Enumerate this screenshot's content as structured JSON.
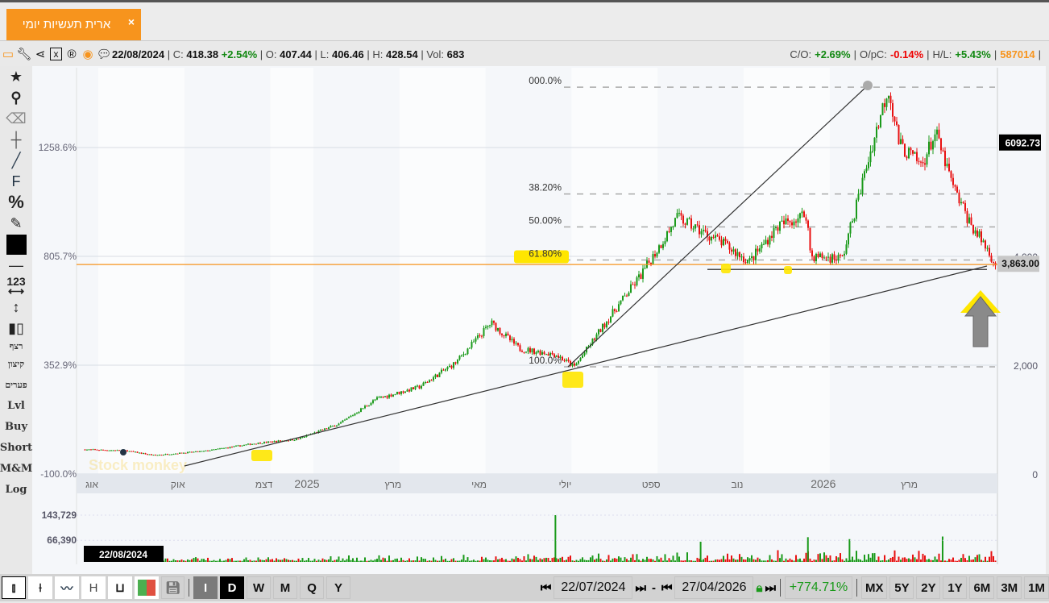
{
  "tab": {
    "title": "ארית תעשיות יומי",
    "close": "×"
  },
  "info": {
    "date": "22/08/2024",
    "c_label": "C:",
    "c": "418.38",
    "c_pct": "+2.54%",
    "o_label": "O:",
    "o": "407.44",
    "l_label": "L:",
    "l": "406.46",
    "h_label": "H:",
    "h": "428.54",
    "vol_label": "Vol:",
    "vol": "683",
    "co_label": "C/O:",
    "co": "+2.69%",
    "opc_label": "O/pC:",
    "opc": "-0.14%",
    "hl_label": "H/L:",
    "hl": "+5.43%",
    "id": "587014",
    "icons": [
      "window-icon",
      "wrench-icon",
      "share-icon",
      "excel-icon",
      "registered-icon",
      "target-icon",
      "comment-icon"
    ]
  },
  "left_tools": {
    "f": "F",
    "pct": "%",
    "num": "123",
    "cont": "רצף",
    "tools": [
      "קיצון",
      "פערים",
      "Lvl",
      "Buy",
      "Short",
      "M&M",
      "Log"
    ]
  },
  "chart_data": {
    "type": "candlestick",
    "watermark": "Stock monkey",
    "x_ticks": [
      {
        "label": "אוג",
        "date": "2024-08-01"
      },
      {
        "label": "אוק",
        "date": "2024-10-01"
      },
      {
        "label": "דצמ",
        "date": "2024-12-01"
      },
      {
        "label": "2025",
        "date": "2025-01-01"
      },
      {
        "label": "מרץ",
        "date": "2025-03-01"
      },
      {
        "label": "מאי",
        "date": "2025-05-01"
      },
      {
        "label": "יולי",
        "date": "2025-07-01"
      },
      {
        "label": "ספט",
        "date": "2025-09-01"
      },
      {
        "label": "נוב",
        "date": "2025-11-01"
      },
      {
        "label": "2026",
        "date": "2026-01-01"
      },
      {
        "label": "מרץ",
        "date": "2026-03-01"
      }
    ],
    "left_axis_pct": [
      "1258.6%",
      "805.7%",
      "352.9%",
      "-100.0%"
    ],
    "left_axis_values": [
      1258.6,
      805.7,
      352.9,
      -100.0
    ],
    "right_axis": [
      "4,000",
      "2,000",
      "0"
    ],
    "right_axis_values": [
      4000,
      2000,
      0
    ],
    "ylim": [
      0,
      7400
    ],
    "last_price_label": "3,863.00",
    "last_price": 3863,
    "marker_label": "6092.73",
    "marker_price": 6092.73,
    "orange_level": 3850,
    "support_level": 3760,
    "price_path": [
      [
        "2024-07-22",
        450
      ],
      [
        "2024-08-20",
        430
      ],
      [
        "2024-09-10",
        345
      ],
      [
        "2024-10-15",
        420
      ],
      [
        "2024-11-20",
        560
      ],
      [
        "2024-12-20",
        640
      ],
      [
        "2025-01-20",
        930
      ],
      [
        "2025-02-15",
        1380
      ],
      [
        "2025-03-15",
        1600
      ],
      [
        "2025-04-10",
        2040
      ],
      [
        "2025-05-05",
        2780
      ],
      [
        "2025-05-25",
        2300
      ],
      [
        "2025-06-20",
        2200
      ],
      [
        "2025-07-03",
        1970
      ],
      [
        "2025-07-25",
        2780
      ],
      [
        "2025-08-20",
        3670
      ],
      [
        "2025-09-15",
        4710
      ],
      [
        "2025-10-15",
        4265
      ],
      [
        "2025-11-05",
        3900
      ],
      [
        "2025-11-25",
        4550
      ],
      [
        "2025-12-15",
        4780
      ],
      [
        "2025-12-18",
        4000
      ],
      [
        "2026-01-10",
        3970
      ],
      [
        "2026-01-28",
        5750
      ],
      [
        "2026-02-12",
        7110
      ],
      [
        "2026-02-20",
        6040
      ],
      [
        "2026-03-05",
        5670
      ],
      [
        "2026-03-15",
        6265
      ],
      [
        "2026-03-28",
        5230
      ],
      [
        "2026-04-10",
        4560
      ],
      [
        "2026-04-20",
        4190
      ],
      [
        "2026-04-27",
        3850
      ]
    ],
    "fib": {
      "high": 7110,
      "low": 1970,
      "levels": [
        {
          "label": "000.0%",
          "r": 0
        },
        {
          "label": "38.20%",
          "r": 0.382
        },
        {
          "label": "50.00%",
          "r": 0.5
        },
        {
          "label": "61.80%",
          "r": 0.618
        },
        {
          "label": "100.0%",
          "r": 1
        }
      ]
    },
    "volume": {
      "ticks": [
        "143,729",
        "66,390"
      ],
      "tick_values": [
        143729,
        66390
      ],
      "spikes": [
        [
          "2025-06-20",
          143729
        ],
        [
          "2025-10-01",
          62000
        ],
        [
          "2025-12-16",
          76000
        ],
        [
          "2026-03-20",
          78000
        ],
        [
          "2026-01-15",
          70000
        ]
      ]
    },
    "cursor_date": "22/08/2024",
    "colors": {
      "up": "#1a9a1a",
      "down": "#e81010",
      "orange": "#f7941d",
      "highlight": "#ffe600"
    }
  },
  "bottom": {
    "views": [
      "I",
      "D",
      "W",
      "M",
      "Q",
      "Y"
    ],
    "start_date": "22/07/2024",
    "end_date": "27/04/2026",
    "dash": "-",
    "change": "+774.71%",
    "ranges": [
      "MX",
      "5Y",
      "2Y",
      "1Y",
      "6M",
      "3M",
      "1M"
    ],
    "h": "H"
  }
}
